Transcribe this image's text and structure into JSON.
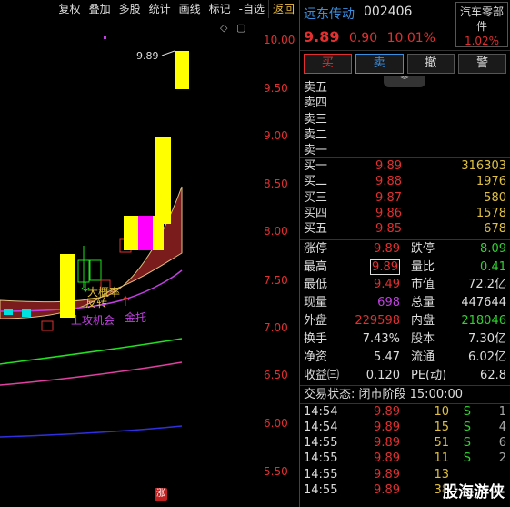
{
  "toolbar": [
    "复权",
    "叠加",
    "多股",
    "统计",
    "画线",
    "标记",
    "-自选",
    "返回"
  ],
  "chart": {
    "price_ticks": [
      "10.00",
      "9.50",
      "9.00",
      "8.50",
      "8.00",
      "7.50",
      "7.00",
      "6.50",
      "6.00",
      "5.50"
    ],
    "peak_label": "9.89",
    "annotations": {
      "bottom_signal": "上攻机会",
      "gold_support": "金托",
      "reversal": "反转",
      "start_rally": "大概率",
      "zhang": "涨"
    },
    "colors": {
      "up": "#ffff00",
      "down": "#00ff00",
      "ma": "#c040e0",
      "cloud": "#8b2020"
    }
  },
  "quote": {
    "name": "远东传动",
    "code": "002406",
    "sector": "汽车零部件",
    "sector_change": "1.02%",
    "price": "9.89",
    "change": "0.90",
    "change_pct": "10.01%",
    "buttons": {
      "buy": "买",
      "sell": "卖",
      "cancel": "撤",
      "alert": "警"
    },
    "collapse": "︾",
    "asks": [
      {
        "label": "卖五",
        "price": "",
        "vol": ""
      },
      {
        "label": "卖四",
        "price": "",
        "vol": ""
      },
      {
        "label": "卖三",
        "price": "",
        "vol": ""
      },
      {
        "label": "卖二",
        "price": "",
        "vol": ""
      },
      {
        "label": "卖一",
        "price": "",
        "vol": ""
      }
    ],
    "bids": [
      {
        "label": "买一",
        "price": "9.89",
        "vol": "316303"
      },
      {
        "label": "买二",
        "price": "9.88",
        "vol": "1976"
      },
      {
        "label": "买三",
        "price": "9.87",
        "vol": "580"
      },
      {
        "label": "买四",
        "price": "9.86",
        "vol": "1578"
      },
      {
        "label": "买五",
        "price": "9.85",
        "vol": "678"
      }
    ],
    "stats": {
      "limit_up_label": "涨停",
      "limit_up": "9.89",
      "limit_down_label": "跌停",
      "limit_down": "8.09",
      "high_label": "最高",
      "high": "9.89",
      "vol_ratio_label": "量比",
      "vol_ratio": "0.41",
      "low_label": "最低",
      "low": "9.49",
      "mkt_cap_label": "市值",
      "mkt_cap": "72.2亿",
      "last_vol_label": "现量",
      "last_vol": "698",
      "total_vol_label": "总量",
      "total_vol": "447644",
      "outer_label": "外盘",
      "outer": "229598",
      "inner_label": "内盘",
      "inner": "218046"
    },
    "fin": {
      "turnover_label": "换手",
      "turnover": "7.43%",
      "equity_label": "股本",
      "equity": "7.30亿",
      "nav_label": "净资",
      "nav": "5.47",
      "float_label": "流通",
      "float": "6.02亿",
      "eps_label": "收益㈢",
      "eps": "0.120",
      "pe_label": "PE(动)",
      "pe": "62.8"
    },
    "status": "交易状态: 闭市阶段 15:00:00",
    "ticks": [
      {
        "time": "14:54",
        "price": "9.89",
        "qty": "10",
        "side": "S",
        "n": "1"
      },
      {
        "time": "14:54",
        "price": "9.89",
        "qty": "15",
        "side": "S",
        "n": "4"
      },
      {
        "time": "14:55",
        "price": "9.89",
        "qty": "51",
        "side": "S",
        "n": "6"
      },
      {
        "time": "14:55",
        "price": "9.89",
        "qty": "11",
        "side": "S",
        "n": "2"
      },
      {
        "time": "14:55",
        "price": "9.89",
        "qty": "13",
        "side": "",
        "n": ""
      },
      {
        "time": "14:55",
        "price": "9.89",
        "qty": "38",
        "side": "",
        "n": ""
      }
    ]
  },
  "watermark": "股海游侠"
}
